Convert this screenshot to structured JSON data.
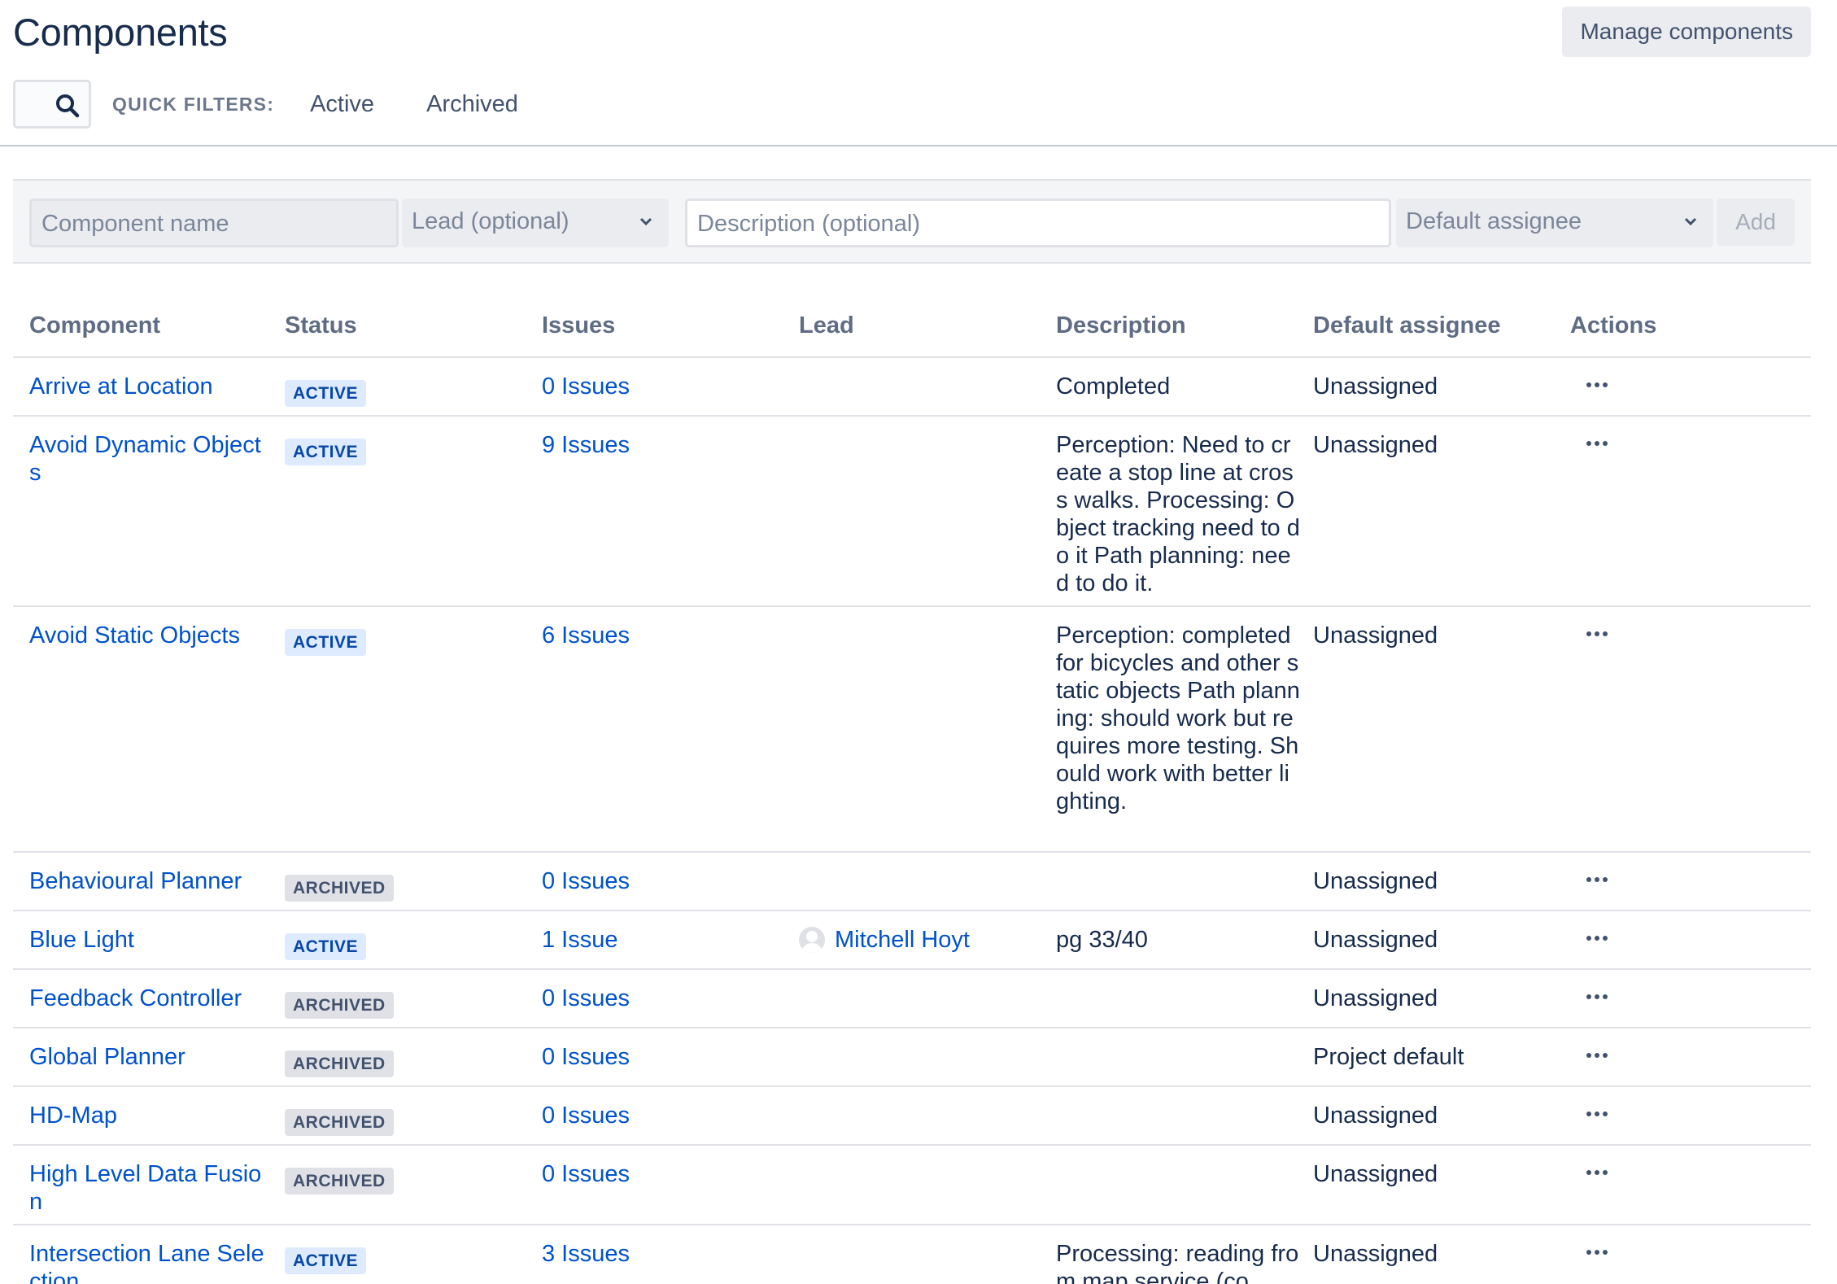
{
  "header": {
    "title": "Components",
    "manage_button": "Manage components"
  },
  "filters": {
    "quick_filters_label": "QUICK FILTERS:",
    "items": [
      "Active",
      "Archived"
    ]
  },
  "add_form": {
    "name_placeholder": "Component name",
    "lead_placeholder": "Lead (optional)",
    "description_placeholder": "Description (optional)",
    "assignee_placeholder": "Default assignee",
    "add_label": "Add"
  },
  "table": {
    "columns": [
      "Component",
      "Status",
      "Issues",
      "Lead",
      "Description",
      "Default assignee",
      "Actions"
    ],
    "rows": [
      {
        "component": "Arrive at Location",
        "status": "ACTIVE",
        "issues": "0 Issues",
        "lead": "",
        "description": "Completed",
        "assignee": "Unassigned"
      },
      {
        "component": "Avoid Dynamic Objects",
        "status": "ACTIVE",
        "issues": "9 Issues",
        "lead": "",
        "description": "Perception: Need to create a stop line at cross walks.  Processing: Object tracking need to do it Path planning:  need to do it.",
        "assignee": "Unassigned"
      },
      {
        "component": "Avoid Static Objects",
        "status": "ACTIVE",
        "issues": "6 Issues",
        "lead": "",
        "description": "Perception: completed for bicycles and other static objects  Path planning:  should work but requires more testing.  Should work with better lighting.",
        "assignee": "Unassigned"
      },
      {
        "component": "Behavioural Planner",
        "status": "ARCHIVED",
        "issues": "0 Issues",
        "lead": "",
        "description": "",
        "assignee": "Unassigned"
      },
      {
        "component": "Blue Light",
        "status": "ACTIVE",
        "issues": "1 Issue",
        "lead": "Mitchell Hoyt",
        "description": "pg 33/40",
        "assignee": "Unassigned"
      },
      {
        "component": "Feedback Controller",
        "status": "ARCHIVED",
        "issues": "0 Issues",
        "lead": "",
        "description": "",
        "assignee": "Unassigned"
      },
      {
        "component": "Global Planner",
        "status": "ARCHIVED",
        "issues": "0 Issues",
        "lead": "",
        "description": "",
        "assignee": "Project default"
      },
      {
        "component": "HD-Map",
        "status": "ARCHIVED",
        "issues": "0 Issues",
        "lead": "",
        "description": "",
        "assignee": "Unassigned"
      },
      {
        "component": "High Level Data Fusion",
        "status": "ARCHIVED",
        "issues": "0 Issues",
        "lead": "",
        "description": "",
        "assignee": "Unassigned"
      },
      {
        "component": "Intersection Lane Selection",
        "status": "ACTIVE",
        "issues": "3 Issues",
        "lead": "",
        "description": "Processing: reading from map service (co",
        "assignee": "Unassigned"
      }
    ]
  }
}
